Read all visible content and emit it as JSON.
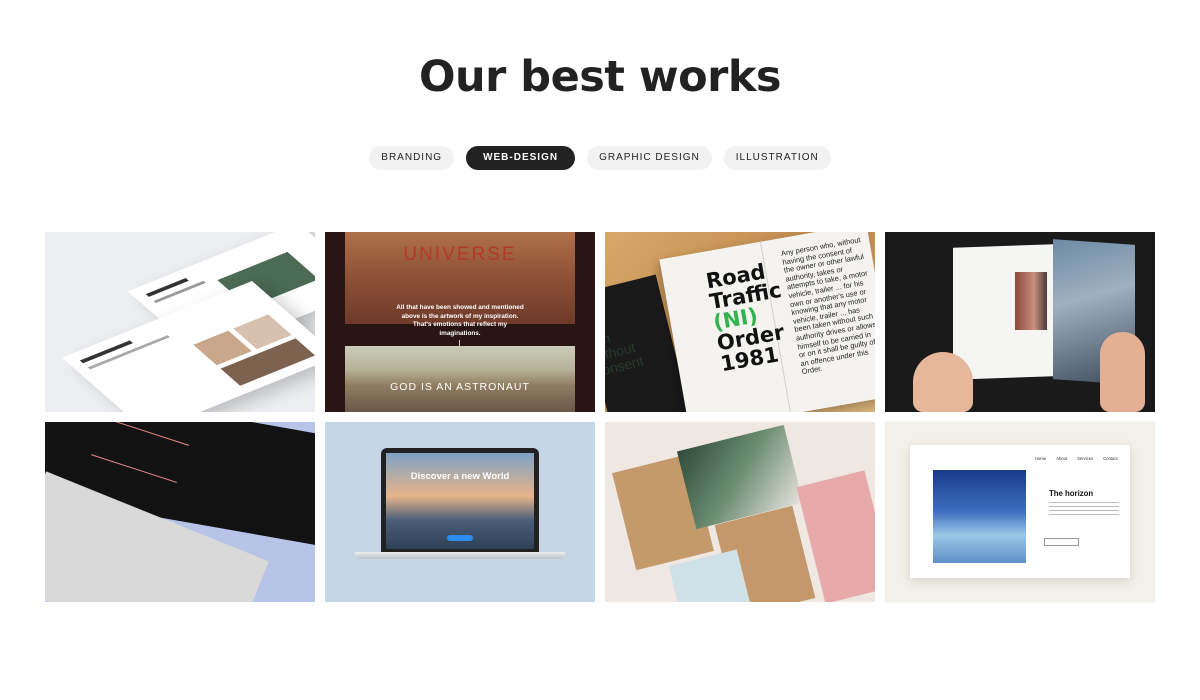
{
  "heading": "Our best works",
  "filters": [
    {
      "label": "BRANDING",
      "active": false
    },
    {
      "label": "WEB-DESIGN",
      "active": true
    },
    {
      "label": "GRAPHIC DESIGN",
      "active": false
    },
    {
      "label": "ILLUSTRATION",
      "active": false
    }
  ],
  "works": {
    "universe": {
      "title": "UNIVERSE",
      "caption": "All that have been showed and mentioned above is the artwork of my inspiration. That's emotions that reflect my imaginations.",
      "subtitle": "GOD IS AN ASTRONAUT"
    },
    "road": {
      "title_lines": [
        "Road",
        "Traffic",
        "(NI)",
        "Order",
        "1981"
      ],
      "body": "Any person who, without having the consent of the owner or other lawful authority, takes or attempts to take, a motor vehicle, trailer ... for his own or another's use or knowing that any motor vehicle, trailer ... has been taken without such authority drives or allows himself to be carried in or on it shall be guilty of an offence under this Order.",
      "side": "can without consent"
    },
    "laptop": {
      "headline": "Discover a new World"
    },
    "horizon": {
      "title": "The horizon",
      "nav": [
        "Home",
        "About",
        "Services",
        "Contact"
      ]
    }
  },
  "colors": {
    "active_filter_bg": "#222222",
    "filter_bg": "#f2f2f2",
    "universe_title": "#b33a2a",
    "road_accent": "#2fb34a"
  }
}
